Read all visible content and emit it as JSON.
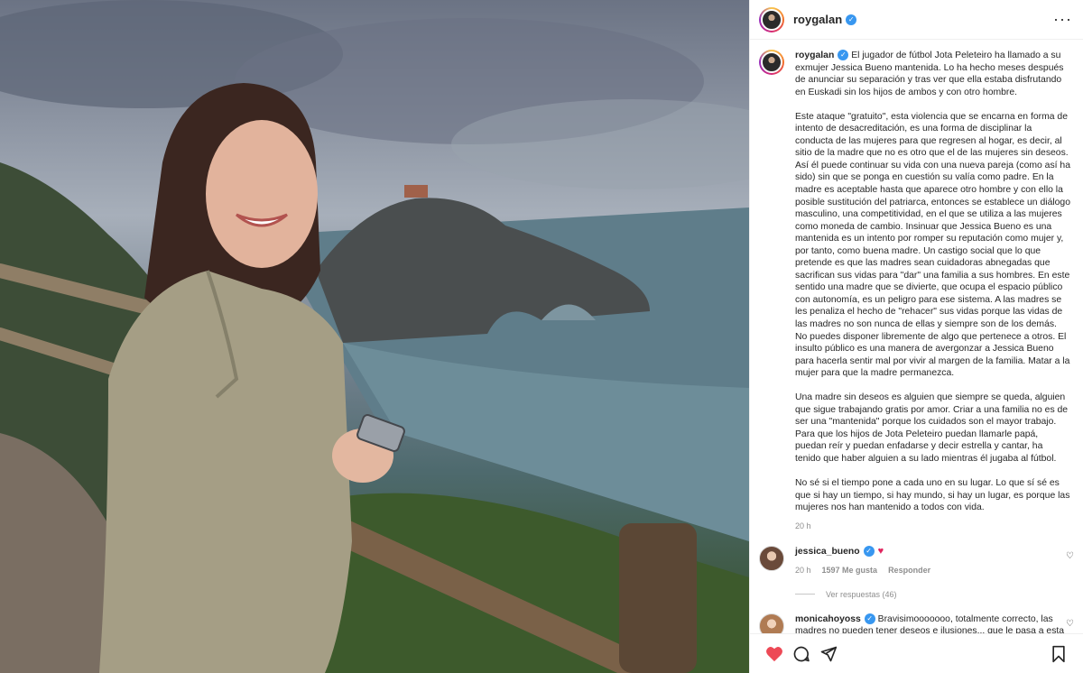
{
  "post": {
    "username": "roygalan",
    "caption": {
      "username": "roygalan",
      "paragraphs": [
        "El jugador de fútbol Jota Peleteiro ha llamado a su exmujer Jessica Bueno mantenida. Lo ha hecho meses después de anunciar su separación y tras ver que ella estaba disfrutando en Euskadi sin los hijos de ambos y con otro hombre.",
        "Este ataque \"gratuito\", esta violencia que se encarna en forma de intento de desacreditación, es una forma de disciplinar la conducta de las mujeres para que regresen al hogar, es decir, al sitio de la madre que no es otro que el de las mujeres sin deseos. Así él puede continuar su vida con una nueva pareja (como así ha sido) sin que se ponga en cuestión su valía como padre. En la madre es aceptable hasta que aparece otro hombre y con ello la posible sustitución del patriarca, entonces se establece un diálogo masculino, una competitividad, en el que se utiliza a las mujeres como moneda de cambio. Insinuar que Jessica Bueno es una mantenida es un intento por romper su reputación como mujer y, por tanto, como buena madre. Un castigo social que lo que pretende es que las madres sean cuidadoras abnegadas que sacrifican sus vidas para \"dar\" una familia a sus hombres. En este sentido una madre que se divierte, que ocupa el espacio público con autonomía, es un peligro para ese sistema. A las madres se les penaliza el hecho de \"rehacer\" sus vidas porque las vidas de las madres no son nunca de ellas y siempre son de los demás. No puedes disponer libremente de algo que pertenece a otros. El insulto público es una manera de avergonzar a Jessica Bueno para hacerla sentir mal por vivir al margen de la familia. Matar a la mujer para que la madre permanezca.",
        "Una madre sin deseos es alguien que siempre se queda, alguien que sigue trabajando gratis por amor. Criar a una familia no es de ser una \"mantenida\" porque los cuidados son el mayor trabajo. Para que los hijos de Jota Peleteiro puedan llamarle papá, puedan reír y puedan enfadarse y decir estrella y cantar, ha tenido que haber alguien a su lado mientras él jugaba al fútbol.",
        "No sé si el tiempo pone a cada uno en su lugar. Lo que sí sé es que si hay un tiempo, si hay mundo, si hay un lugar, es porque las mujeres nos han mantenido a todos con vida."
      ],
      "time": "20 h"
    },
    "comments": [
      {
        "username": "jessica_bueno",
        "text": "",
        "time": "20 h",
        "likes": "1597 Me gusta",
        "reply_label": "Responder",
        "view_replies": "Ver respuestas (46)"
      },
      {
        "username": "monicahoyoss",
        "text": "Bravisimooooooo, totalmente correcto, las madres no pueden tener deseos e ilusiones... que le pasa a esta sociedad ?!!"
      }
    ]
  },
  "icons": {
    "more": "more-options-icon",
    "like": "heart-icon",
    "comment": "comment-icon",
    "share": "share-icon",
    "save": "bookmark-icon",
    "verified": "verified-badge-icon"
  },
  "colors": {
    "verified": "#3897f0",
    "like": "#ed4956",
    "meta": "#8e8e8e"
  }
}
